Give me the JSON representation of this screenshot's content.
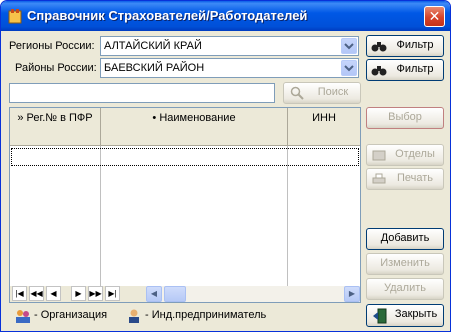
{
  "window": {
    "title": "Справочник Страхователей/Работодателей"
  },
  "filters": {
    "region_label": "Регионы России:",
    "region_value": "АЛТАЙСКИЙ КРАЙ",
    "district_label": "Районы России:",
    "district_value": "БАЕВСКИЙ РАЙОН",
    "filter_button_1": "Фильтр",
    "filter_button_2": "Фильтр"
  },
  "search": {
    "value": "",
    "button_label": "Поиск"
  },
  "grid": {
    "columns": [
      "» Рег.№ в ПФР",
      "• Наименование",
      "ИНН"
    ],
    "rows": []
  },
  "actions": {
    "select": "Выбор",
    "departments": "Отделы",
    "print": "Печать",
    "add": "Добавить",
    "edit": "Изменить",
    "delete": "Удалить",
    "close": "Закрыть"
  },
  "legend": {
    "organization": "- Организация",
    "entrepreneur": "- Инд.предприниматель"
  }
}
